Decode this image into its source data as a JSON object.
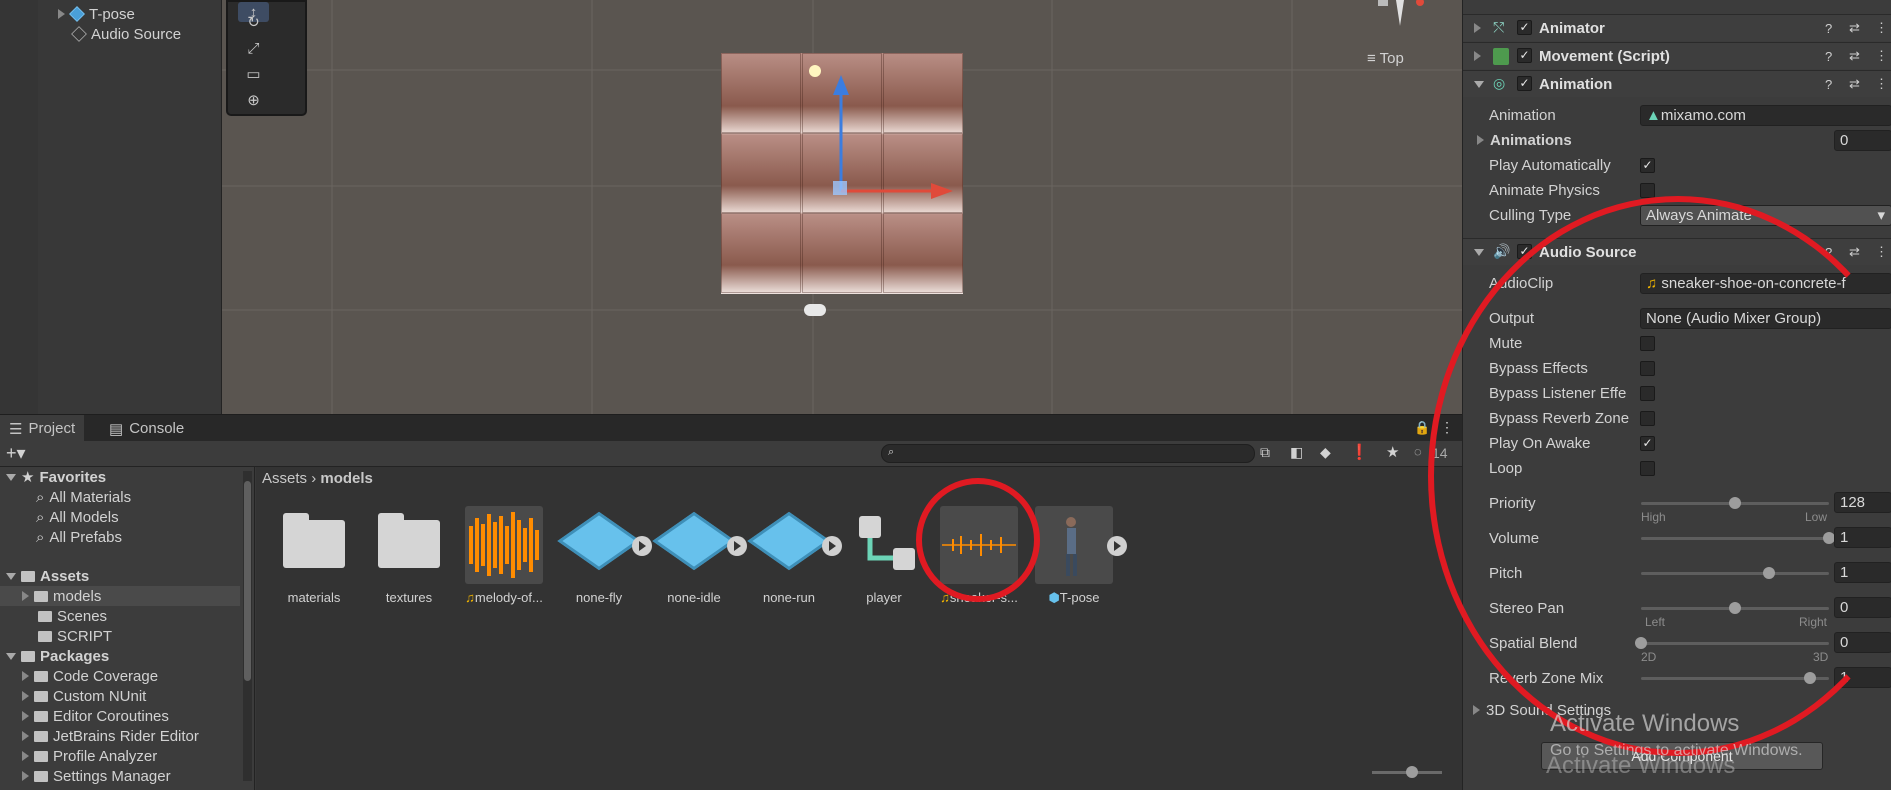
{
  "hierarchy": {
    "items": [
      {
        "label": "T-pose"
      },
      {
        "label": "Audio Source"
      }
    ]
  },
  "scene": {
    "view_label": "Top"
  },
  "inspector": {
    "components": [
      {
        "name": "Animator"
      },
      {
        "name": "Movement (Script)"
      },
      {
        "name": "Animation"
      },
      {
        "name": "Audio Source"
      }
    ],
    "animation": {
      "animation_label": "Animation",
      "animation_value": "mixamo.com",
      "animations_label": "Animations",
      "animations_value": "0",
      "play_auto_label": "Play Automatically",
      "play_auto_checked": true,
      "animate_physics_label": "Animate Physics",
      "animate_physics_checked": false,
      "culling_label": "Culling Type",
      "culling_value": "Always Animate"
    },
    "audio": {
      "clip_label": "AudioClip",
      "clip_value": "sneaker-shoe-on-concrete-f",
      "output_label": "Output",
      "output_value": "None (Audio Mixer Group)",
      "mute_label": "Mute",
      "mute_checked": false,
      "bypass_effects_label": "Bypass Effects",
      "bypass_effects_checked": false,
      "bypass_listener_label": "Bypass Listener Effe",
      "bypass_listener_checked": false,
      "bypass_reverb_label": "Bypass Reverb Zone",
      "bypass_reverb_checked": false,
      "play_on_awake_label": "Play On Awake",
      "play_on_awake_checked": true,
      "loop_label": "Loop",
      "loop_checked": false,
      "priority_label": "Priority",
      "priority_value": "128",
      "priority_high": "High",
      "priority_low": "Low",
      "priority_fraction": 0.5,
      "volume_label": "Volume",
      "volume_value": "1",
      "volume_fraction": 1.0,
      "pitch_label": "Pitch",
      "pitch_value": "1",
      "pitch_fraction": 0.68,
      "stereo_label": "Stereo Pan",
      "stereo_value": "0",
      "stereo_left": "Left",
      "stereo_right": "Right",
      "stereo_fraction": 0.5,
      "spatial_label": "Spatial Blend",
      "spatial_value": "0",
      "spatial_2d": "2D",
      "spatial_3d": "3D",
      "spatial_fraction": 0.0,
      "reverb_mix_label": "Reverb Zone Mix",
      "reverb_mix_value": "1",
      "reverb_mix_fraction": 0.9,
      "sound3d_label": "3D Sound Settings"
    },
    "add_component": "Add Component"
  },
  "project": {
    "tabs": [
      {
        "label": "Project"
      },
      {
        "label": "Console"
      }
    ],
    "hidden_count": "14",
    "tree": [
      {
        "label": "Favorites",
        "bold": true
      },
      {
        "label": "All Materials"
      },
      {
        "label": "All Models"
      },
      {
        "label": "All Prefabs"
      },
      {
        "label": "Assets",
        "bold": true
      },
      {
        "label": "models"
      },
      {
        "label": "Scenes"
      },
      {
        "label": "SCRIPT"
      },
      {
        "label": "Packages",
        "bold": true
      },
      {
        "label": "Code Coverage"
      },
      {
        "label": "Custom NUnit"
      },
      {
        "label": "Editor Coroutines"
      },
      {
        "label": "JetBrains Rider Editor"
      },
      {
        "label": "Profile Analyzer"
      },
      {
        "label": "Settings Manager"
      }
    ],
    "breadcrumb": {
      "root": "Assets",
      "current": "models"
    },
    "assets": [
      {
        "label": "materials",
        "type": "folder"
      },
      {
        "label": "textures",
        "type": "folder"
      },
      {
        "label": "melody-of...",
        "type": "audio"
      },
      {
        "label": "none-fly",
        "type": "model"
      },
      {
        "label": "none-idle",
        "type": "model"
      },
      {
        "label": "none-run",
        "type": "model"
      },
      {
        "label": "player",
        "type": "prefab"
      },
      {
        "label": "sneaker-s...",
        "type": "audio"
      },
      {
        "label": "T-pose",
        "type": "model"
      }
    ]
  },
  "watermark": {
    "title": "Activate Windows",
    "subtitle": "Go to Settings to activate Windows."
  },
  "colors": {
    "highlight_circle": "#e01a22",
    "audio_orange": "#ff8c00",
    "model_blue": "#67c1ec"
  }
}
